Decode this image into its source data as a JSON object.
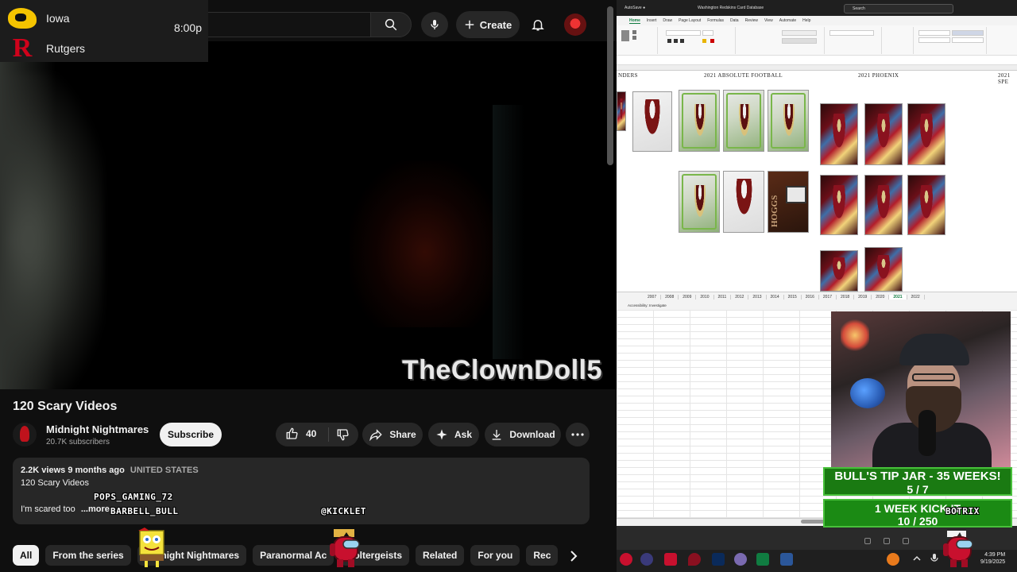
{
  "scoreboard": {
    "team1": "Iowa",
    "team2": "Rutgers",
    "time": "8:00p"
  },
  "header": {
    "create_label": "Create"
  },
  "video": {
    "watermark": "TheClownDoll5",
    "title": "120 Scary Videos"
  },
  "channel": {
    "name": "Midnight Nightmares",
    "subscribers": "20.7K subscribers",
    "subscribe_label": "Subscribe"
  },
  "actions": {
    "likes": "40",
    "share": "Share",
    "ask": "Ask",
    "download": "Download"
  },
  "description": {
    "views": "2.2K views",
    "age": "9 months ago",
    "location": "UNITED STATES",
    "line1": "120 Scary Videos",
    "line2": "I'm scared too",
    "more": "...more"
  },
  "chips": [
    "All",
    "From the series",
    "Midnight Nightmares",
    "Paranormal Ac",
    "Poltergeists",
    "Related",
    "For you",
    "Rec"
  ],
  "overlay": {
    "user1": "POPS_GAMING_72",
    "user2": "BARBELL_BULL",
    "user3": "@KICKLET",
    "user4": "BOTRIX"
  },
  "excel": {
    "title": "Washington Redskins Card Database",
    "search_placeholder": "Search",
    "tabs": [
      "Home",
      "Insert",
      "Draw",
      "Page Layout",
      "Formulas",
      "Data",
      "Review",
      "View",
      "Automate",
      "Help"
    ],
    "headers": [
      "NDERS",
      "2021 ABSOLUTE FOOTBALL",
      "2021 PHOENIX",
      "2021 SPE"
    ],
    "sheet_tabs": [
      "2007",
      "2008",
      "2009",
      "2010",
      "2011",
      "2012",
      "2013",
      "2014",
      "2015",
      "2016",
      "2017",
      "2018",
      "2019",
      "2020",
      "2021",
      "2022"
    ],
    "active_sheet": "2021",
    "status": "Accessibility: Investigate"
  },
  "tipjar": {
    "line1": "BULL'S TIP JAR - 35 WEEKS!",
    "line2": "5 / 7"
  },
  "goal": {
    "line1": "1 WEEK KICK IT",
    "line2": "10 / 250"
  },
  "taskbar": {
    "time": "4:39 PM",
    "date": "9/19/2025"
  },
  "colors": {
    "youtube_bg": "#0f0f0f",
    "pill_bg": "#272727",
    "excel_green": "#107c41",
    "tipjar_green": "#1b8a14"
  }
}
